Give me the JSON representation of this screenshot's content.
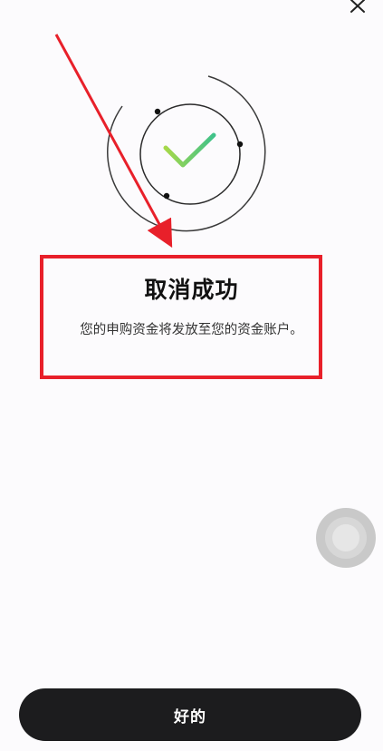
{
  "dialog": {
    "title": "取消成功",
    "message": "您的申购资金将发放至您的资金账户。",
    "ok_label": "好的"
  },
  "icons": {
    "close": "close-icon",
    "success": "success-check-icon",
    "annotation_arrow": "red-arrow-annotation",
    "assistive_touch": "assistive-touch-icon"
  },
  "colors": {
    "check_gradient_start": "#a6d84a",
    "check_gradient_end": "#3fc28a",
    "annotation_red": "#e8202a",
    "button_background": "#1c1c1e"
  }
}
